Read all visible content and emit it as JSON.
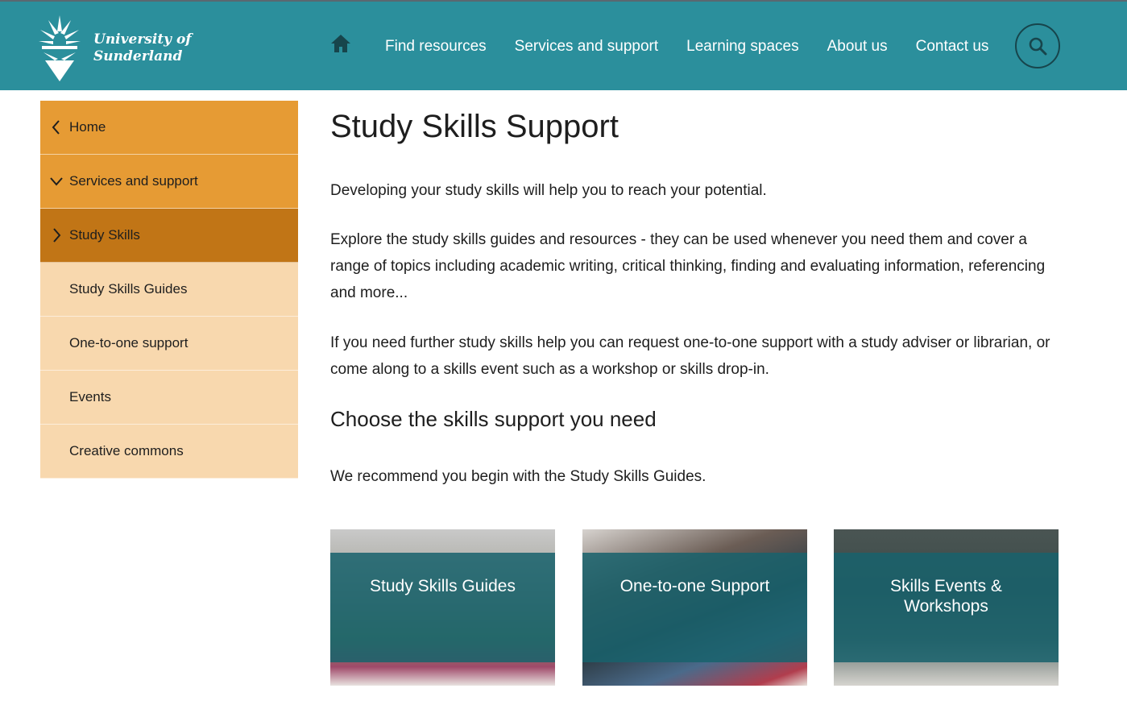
{
  "header": {
    "logo_line1": "University of",
    "logo_line2": "Sunderland",
    "nav": [
      "Find resources",
      "Services and support",
      "Learning spaces",
      "About us",
      "Contact us"
    ],
    "home_icon": "home-icon",
    "search_icon": "search-icon",
    "bg_color": "#2b8f9c"
  },
  "sidebar": {
    "items": [
      {
        "label": "Home",
        "state": "top",
        "icon": "chevron-left-icon"
      },
      {
        "label": "Services and support",
        "state": "top",
        "icon": "chevron-down-icon"
      },
      {
        "label": "Study Skills",
        "state": "active",
        "icon": "chevron-right-icon"
      },
      {
        "label": "Study Skills Guides",
        "state": "sub"
      },
      {
        "label": "One-to-one support",
        "state": "sub"
      },
      {
        "label": "Events",
        "state": "sub"
      },
      {
        "label": "Creative commons",
        "state": "sub"
      }
    ]
  },
  "main": {
    "title": "Study Skills Support",
    "p1": "Developing your study skills will help you to reach your potential.",
    "p2": "Explore the study skills guides and resources - they can be used whenever you need them and cover a range of topics including academic writing, critical thinking, finding and evaluating information, referencing and more...",
    "p3": "If you need further study skills help you can request one-to-one support with a study adviser or librarian, or come along to a skills event such as a workshop or skills drop-in.",
    "subheading": "Choose the skills support you need",
    "p4": "We recommend you begin with the Study Skills Guides.",
    "cards": [
      {
        "label": "Study Skills Guides"
      },
      {
        "label": "One-to-one Support"
      },
      {
        "label": "Skills Events & Workshops"
      }
    ]
  }
}
